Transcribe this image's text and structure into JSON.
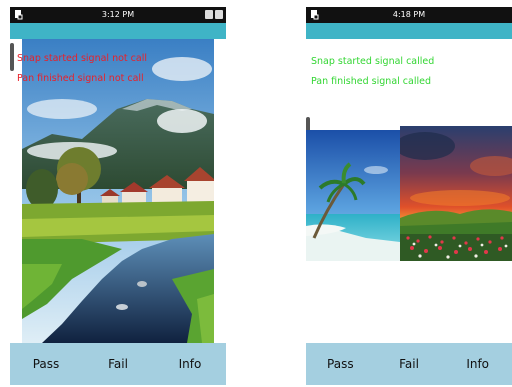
{
  "screens": [
    {
      "status_bar": {
        "time": "3:12 PM"
      },
      "messages": [
        {
          "text": "Snap started signal not call"
        },
        {
          "text": "Pan finished signal not call"
        }
      ],
      "message_color": "#e8202a",
      "image_subject": "mountain-river-landscape",
      "buttons": {
        "pass": "Pass",
        "fail": "Fail",
        "info": "Info"
      }
    },
    {
      "status_bar": {
        "time": "4:18 PM"
      },
      "messages": [
        {
          "text": "Snap started signal called"
        },
        {
          "text": "Pan finished signal called"
        }
      ],
      "message_color": "#33d633",
      "image_subjects": [
        "beach-palm-tree",
        "sunset-flower-field"
      ],
      "buttons": {
        "pass": "Pass",
        "fail": "Fail",
        "info": "Info"
      }
    }
  ],
  "colors": {
    "status_bar": "#111111",
    "title_strip": "#3fb4c6",
    "bottom_bar": "#a4cfe0"
  }
}
